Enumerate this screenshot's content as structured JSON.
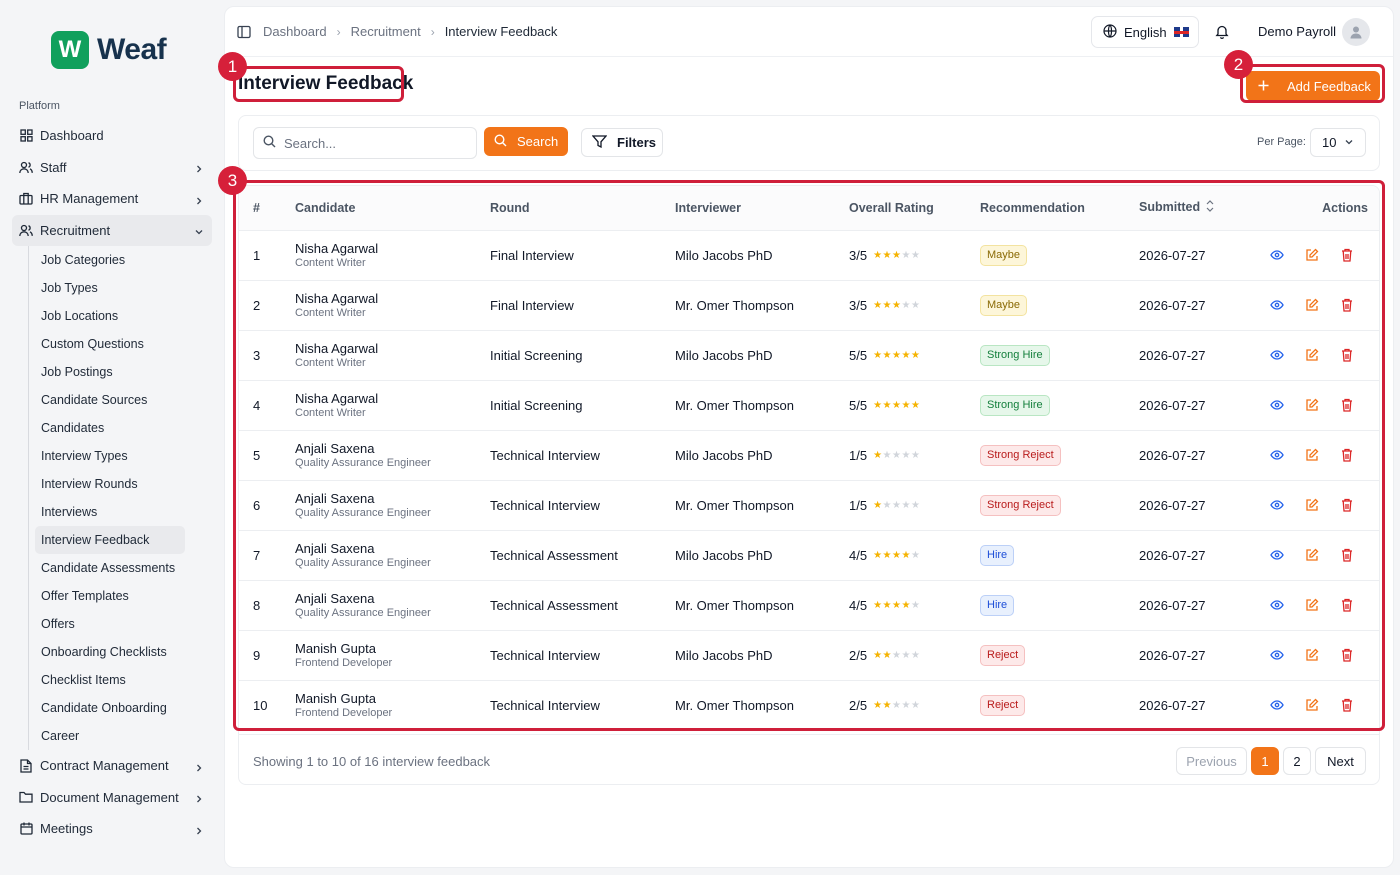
{
  "brand": {
    "logo_letter": "W",
    "name": "Weaf",
    "color": "#10a05c"
  },
  "sidebar": {
    "section_label": "Platform",
    "items": [
      {
        "label": "Dashboard",
        "icon": "grid-icon"
      },
      {
        "label": "Staff",
        "icon": "users-icon"
      },
      {
        "label": "HR Management",
        "icon": "briefcase-icon"
      },
      {
        "label": "Recruitment",
        "icon": "users-icon"
      }
    ],
    "recruitment_sub": [
      "Job Categories",
      "Job Types",
      "Job Locations",
      "Custom Questions",
      "Job Postings",
      "Candidate Sources",
      "Candidates",
      "Interview Types",
      "Interview Rounds",
      "Interviews",
      "Interview Feedback",
      "Candidate Assessments",
      "Offer Templates",
      "Offers",
      "Onboarding Checklists",
      "Checklist Items",
      "Candidate Onboarding",
      "Career"
    ],
    "bottom_items": [
      {
        "label": "Contract Management",
        "icon": "file-icon"
      },
      {
        "label": "Document Management",
        "icon": "folder-icon"
      },
      {
        "label": "Meetings",
        "icon": "calendar-icon"
      }
    ]
  },
  "header": {
    "breadcrumb": [
      "Dashboard",
      "Recruitment",
      "Interview Feedback"
    ],
    "language": "English",
    "user_name": "Demo Payroll"
  },
  "page": {
    "title": "Interview Feedback",
    "add_button": "Add Feedback",
    "accent": "#f27418"
  },
  "markers": [
    "1",
    "2",
    "3"
  ],
  "filters": {
    "search_placeholder": "Search...",
    "search_button": "Search",
    "filters_button": "Filters",
    "per_page_label": "Per Page:",
    "per_page_value": "10"
  },
  "table": {
    "headers": [
      "#",
      "Candidate",
      "Round",
      "Interviewer",
      "Overall Rating",
      "Recommendation",
      "Submitted",
      "Actions"
    ],
    "rows": [
      {
        "num": "1",
        "name": "Nisha Agarwal",
        "role": "Content Writer",
        "round": "Final Interview",
        "interviewer": "Milo Jacobs PhD",
        "rating": "3/5",
        "stars": 3,
        "rec": "Maybe",
        "rec_class": "b-maybe",
        "date": "2026-07-27"
      },
      {
        "num": "2",
        "name": "Nisha Agarwal",
        "role": "Content Writer",
        "round": "Final Interview",
        "interviewer": "Mr. Omer Thompson",
        "rating": "3/5",
        "stars": 3,
        "rec": "Maybe",
        "rec_class": "b-maybe",
        "date": "2026-07-27"
      },
      {
        "num": "3",
        "name": "Nisha Agarwal",
        "role": "Content Writer",
        "round": "Initial Screening",
        "interviewer": "Milo Jacobs PhD",
        "rating": "5/5",
        "stars": 5,
        "rec": "Strong Hire",
        "rec_class": "b-strong-hire",
        "date": "2026-07-27"
      },
      {
        "num": "4",
        "name": "Nisha Agarwal",
        "role": "Content Writer",
        "round": "Initial Screening",
        "interviewer": "Mr. Omer Thompson",
        "rating": "5/5",
        "stars": 5,
        "rec": "Strong Hire",
        "rec_class": "b-strong-hire",
        "date": "2026-07-27"
      },
      {
        "num": "5",
        "name": "Anjali Saxena",
        "role": "Quality Assurance Engineer",
        "round": "Technical Interview",
        "interviewer": "Milo Jacobs PhD",
        "rating": "1/5",
        "stars": 1,
        "rec": "Strong Reject",
        "rec_class": "b-strong-reject",
        "date": "2026-07-27"
      },
      {
        "num": "6",
        "name": "Anjali Saxena",
        "role": "Quality Assurance Engineer",
        "round": "Technical Interview",
        "interviewer": "Mr. Omer Thompson",
        "rating": "1/5",
        "stars": 1,
        "rec": "Strong Reject",
        "rec_class": "b-strong-reject",
        "date": "2026-07-27"
      },
      {
        "num": "7",
        "name": "Anjali Saxena",
        "role": "Quality Assurance Engineer",
        "round": "Technical Assessment",
        "interviewer": "Milo Jacobs PhD",
        "rating": "4/5",
        "stars": 4,
        "rec": "Hire",
        "rec_class": "b-hire",
        "date": "2026-07-27"
      },
      {
        "num": "8",
        "name": "Anjali Saxena",
        "role": "Quality Assurance Engineer",
        "round": "Technical Assessment",
        "interviewer": "Mr. Omer Thompson",
        "rating": "4/5",
        "stars": 4,
        "rec": "Hire",
        "rec_class": "b-hire",
        "date": "2026-07-27"
      },
      {
        "num": "9",
        "name": "Manish Gupta",
        "role": "Frontend Developer",
        "round": "Technical Interview",
        "interviewer": "Milo Jacobs PhD",
        "rating": "2/5",
        "stars": 2,
        "rec": "Reject",
        "rec_class": "b-reject",
        "date": "2026-07-27"
      },
      {
        "num": "10",
        "name": "Manish Gupta",
        "role": "Frontend Developer",
        "round": "Technical Interview",
        "interviewer": "Mr. Omer Thompson",
        "rating": "2/5",
        "stars": 2,
        "rec": "Reject",
        "rec_class": "b-reject",
        "date": "2026-07-27"
      }
    ]
  },
  "footer": {
    "showing": "Showing 1 to 10 of 16 interview feedback",
    "previous": "Previous",
    "pages": [
      "1",
      "2"
    ],
    "next": "Next"
  }
}
